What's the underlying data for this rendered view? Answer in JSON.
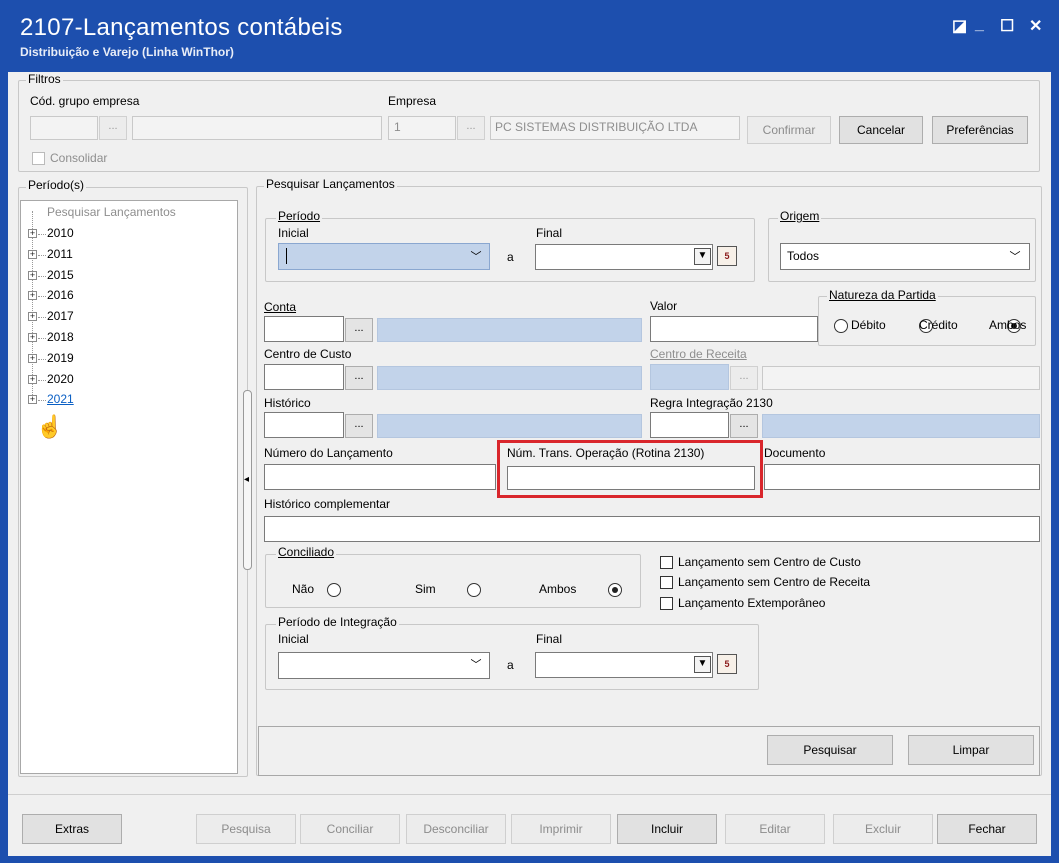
{
  "window": {
    "title": "2107-Lançamentos contábeis",
    "subtitle": "Distribuição e Varejo (Linha WinThor)",
    "controls": [
      "restore-icon",
      "minimize-icon",
      "maximize-icon",
      "close-icon"
    ]
  },
  "filtros": {
    "group_label": "Filtros",
    "cod_grupo_label": "Cód. grupo empresa",
    "empresa_label": "Empresa",
    "empresa_code": "1",
    "empresa_name": "PC SISTEMAS DISTRIBUIÇÃO LTDA",
    "confirmar": "Confirmar",
    "cancelar": "Cancelar",
    "preferencias": "Preferências",
    "consolidar": "Consolidar"
  },
  "periodos": {
    "group_label": "Período(s)",
    "root": "Pesquisar Lançamentos",
    "years": [
      "2010",
      "2011",
      "2015",
      "2016",
      "2017",
      "2018",
      "2019",
      "2020",
      "2021"
    ]
  },
  "pesquisa": {
    "group_label": "Pesquisar Lançamentos",
    "periodo_label": "Período",
    "inicial_label": "Inicial",
    "final_label": "Final",
    "a_label": "a",
    "origem_label": "Origem",
    "origem_value": "Todos",
    "conta_label": "Conta",
    "valor_label": "Valor",
    "natureza_label": "Natureza da Partida",
    "debito": "Débito",
    "credito": "Crédito",
    "ambos": "Ambos",
    "centro_custo_label": "Centro de Custo",
    "centro_receita_label": "Centro de Receita",
    "historico_label": "Histórico",
    "regra_label": "Regra Integração 2130",
    "num_lanc_label": "Número do Lançamento",
    "num_trans_label": "Núm. Trans. Operação (Rotina 2130)",
    "documento_label": "Documento",
    "hist_comp_label": "Histórico complementar",
    "conciliado_label": "Conciliado",
    "nao": "Não",
    "sim": "Sim",
    "ambos2": "Ambos",
    "chk_sem_custo": "Lançamento sem Centro de Custo",
    "chk_sem_receita": "Lançamento sem Centro de Receita",
    "chk_extemporaneo": "Lançamento Extemporâneo",
    "per_integracao_label": "Período de Integração",
    "pesquisar_btn": "Pesquisar",
    "limpar_btn": "Limpar",
    "dots": "..."
  },
  "footer": {
    "extras": "Extras",
    "pesquisa": "Pesquisa",
    "conciliar": "Conciliar",
    "desconciliar": "Desconciliar",
    "imprimir": "Imprimir",
    "incluir": "Incluir",
    "editar": "Editar",
    "excluir": "Excluir",
    "fechar": "Fechar"
  },
  "colors": {
    "titlebar": "#1d4fae",
    "highlight": "#d9262c",
    "field_blue": "#c2d3ea"
  }
}
